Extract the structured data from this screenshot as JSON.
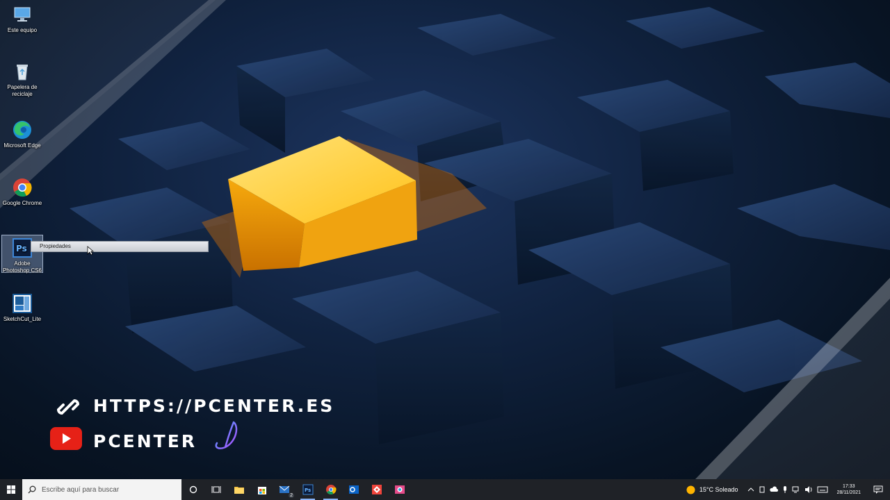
{
  "desktop": {
    "icons": [
      {
        "label": "Este equipo",
        "icon": "computer-icon"
      },
      {
        "label": "Papelera de reciclaje",
        "icon": "recycle-bin-icon"
      },
      {
        "label": "Microsoft Edge",
        "icon": "edge-icon"
      },
      {
        "label": "Google Chrome",
        "icon": "chrome-icon"
      },
      {
        "label": "Adobe Photoshop CS6",
        "icon": "photoshop-icon",
        "selected": true
      },
      {
        "label": "SketchCut_Lite",
        "icon": "sketchcut-icon"
      }
    ],
    "rename_box_text": "Propiedades"
  },
  "overlay": {
    "url_text": "HTTPS://PCENTER.ES",
    "channel_text": "PCENTER"
  },
  "taskbar": {
    "search_placeholder": "Escribe aquí para buscar",
    "apps": [
      "task-view-icon",
      "file-explorer-icon",
      "store-icon",
      "mail-icon",
      "photoshop-icon",
      "chrome-icon",
      "outlook-icon",
      "anydesk-icon",
      "paint-icon"
    ],
    "mail_badge": "2",
    "weather": "15°C  Soleado",
    "time": "17:33",
    "date": "28/11/2021"
  },
  "colors": {
    "accent_yellow": "#ffc21a",
    "taskbar_bg": "#1f2227",
    "youtube_red": "#e62117"
  }
}
